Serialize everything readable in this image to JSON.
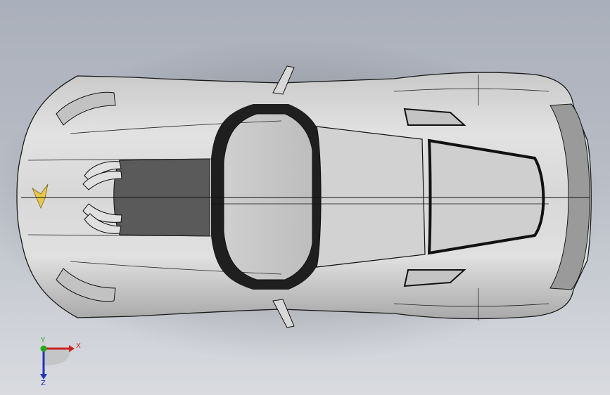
{
  "viewport": {
    "background_top": "#aab0bb",
    "background_bottom": "#d9dbe0"
  },
  "model": {
    "body_color": "#d6d6d6",
    "glass_color": "#bfbfbf",
    "dark_trim_color": "#2a2a2a",
    "hood_panel_color": "#5a5a5a",
    "emblem_color": "#e8c84a",
    "edge_color": "#1a1a1a"
  },
  "triad": {
    "x_label": "X",
    "y_label": "Y",
    "z_label": "Z",
    "x_color": "#cc2222",
    "y_color": "#22aa22",
    "z_color": "#2233bb"
  }
}
